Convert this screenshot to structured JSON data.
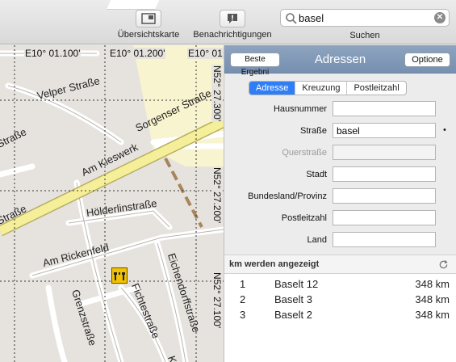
{
  "toolbar": {
    "overview_label": "Übersichtskarte",
    "overview_icon": "overview-map-icon",
    "notifications_label": "Benachrichtigungen",
    "notifications_icon": "notification-icon",
    "search_value": "basel",
    "search_label": "Suchen"
  },
  "map": {
    "coords_top": [
      "E10° 01.100'",
      "E10° 01.200'",
      "E10° 01."
    ],
    "coords_right": [
      "N52° 27.300'",
      "N52° 27.200'",
      "N52° 27.100'"
    ],
    "streets": [
      "Velper Straße",
      "Sorgenser Straße",
      "Am Kieswerk",
      "Hölderlinstraße",
      "Am Rickenfeld",
      "Eichendorffstraße",
      "Grenzstraße",
      "Fichtestraße",
      "Straße",
      "Straße",
      "K"
    ],
    "poi_icon": "construction-icon"
  },
  "panel": {
    "best_results_button": "Beste Ergebni",
    "title": "Adressen",
    "options_button": "Optione",
    "tabs": [
      "Adresse",
      "Kreuzung",
      "Postleitzahl"
    ],
    "fields": [
      {
        "label": "Hausnummer",
        "value": "",
        "enabled": true
      },
      {
        "label": "Straße",
        "value": "basel",
        "enabled": true
      },
      {
        "label": "Querstraße",
        "value": "",
        "enabled": false
      },
      {
        "label": "Stadt",
        "value": "",
        "enabled": true
      },
      {
        "label": "Bundesland/Provinz",
        "value": "",
        "enabled": true
      },
      {
        "label": "Postleitzahl",
        "value": "",
        "enabled": true
      },
      {
        "label": "Land",
        "value": "",
        "enabled": true
      }
    ],
    "street_marker": "•",
    "results_header": "km werden angezeigt",
    "results": [
      {
        "n": "1",
        "name": "Baselt 12",
        "dist": "348 km"
      },
      {
        "n": "2",
        "name": "Baselt 3",
        "dist": "348 km"
      },
      {
        "n": "3",
        "name": "Baselt 2",
        "dist": "348 km"
      }
    ]
  },
  "colors": {
    "panel_header": "#7f98b8",
    "segment_active": "#2f7ef6",
    "major_road": "#f5ef9a",
    "map_background": "#e6e3de"
  }
}
